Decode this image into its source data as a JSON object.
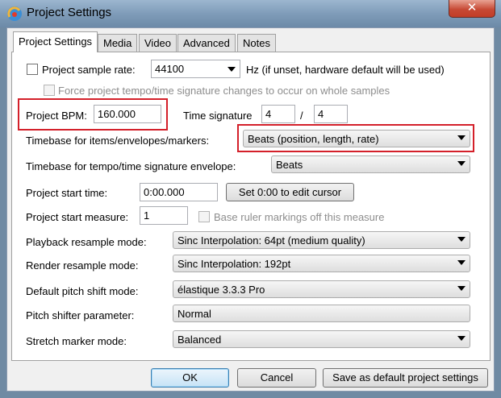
{
  "window": {
    "title": "Project Settings",
    "close_glyph": "✕",
    "app_icon": "reaper-icon"
  },
  "tabs": [
    {
      "label": "Project Settings",
      "active": true
    },
    {
      "label": "Media",
      "active": false
    },
    {
      "label": "Video",
      "active": false
    },
    {
      "label": "Advanced",
      "active": false
    },
    {
      "label": "Notes",
      "active": false
    }
  ],
  "sample_rate": {
    "label": "Project sample rate:",
    "checked": false,
    "value": "44100",
    "note": "Hz (if unset, hardware default will be used)"
  },
  "force_tempo": {
    "label": "Force project tempo/time signature changes to occur on whole samples",
    "checked": false,
    "disabled": true
  },
  "bpm": {
    "label": "Project BPM:",
    "value": "160.000"
  },
  "time_signature": {
    "label": "Time signature",
    "numerator": "4",
    "separator": "/",
    "denominator": "4"
  },
  "timebase_items": {
    "label": "Timebase for items/envelopes/markers:",
    "value": "Beats (position, length, rate)"
  },
  "timebase_tempo": {
    "label": "Timebase for tempo/time signature envelope:",
    "value": "Beats"
  },
  "start_time": {
    "label": "Project start time:",
    "value": "0:00.000",
    "button": "Set 0:00 to edit cursor"
  },
  "start_measure": {
    "label": "Project start measure:",
    "value": "1",
    "base_ruler_label": "Base ruler markings off this measure",
    "base_ruler_checked": false
  },
  "playback_resample": {
    "label": "Playback resample mode:",
    "value": "Sinc Interpolation: 64pt (medium quality)"
  },
  "render_resample": {
    "label": "Render resample mode:",
    "value": "Sinc Interpolation: 192pt"
  },
  "pitch_shift": {
    "label": "Default pitch shift mode:",
    "value": "élastique 3.3.3 Pro"
  },
  "pitch_param": {
    "label": "Pitch shifter parameter:",
    "value": "Normal"
  },
  "stretch_marker": {
    "label": "Stretch marker mode:",
    "value": "Balanced"
  },
  "buttons": {
    "ok": "OK",
    "cancel": "Cancel",
    "save_default": "Save as default project settings"
  },
  "highlight_color": "#d4202a"
}
